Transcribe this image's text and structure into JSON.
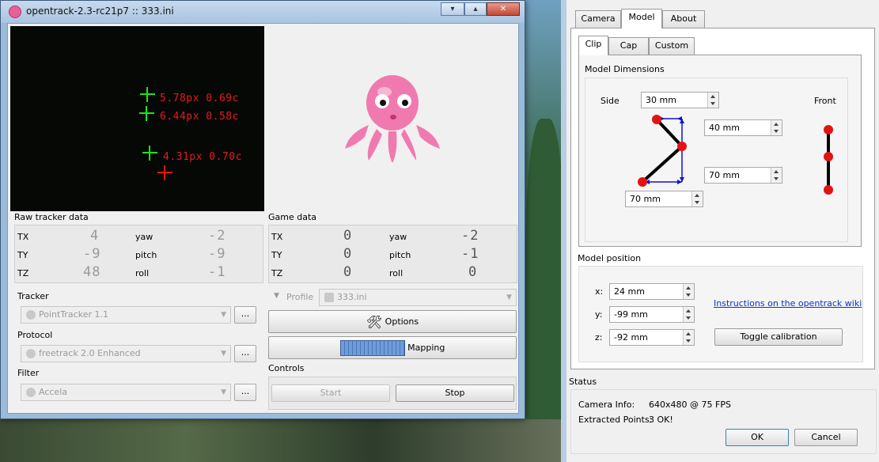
{
  "main_window": {
    "title": "opentrack-2.3-rc21p7 :: 333.ini",
    "minimize_glyph": "▾",
    "restore_glyph": "▴",
    "close_glyph": "✕",
    "video_labels": [
      "5.78px 0.69c",
      "6.44px 0.58c",
      "4.31px 0.70c"
    ]
  },
  "raw_tracker": {
    "title": "Raw tracker data",
    "rows": [
      {
        "label": "TX",
        "value": "4",
        "rot_label": "yaw",
        "rot_value": "-2"
      },
      {
        "label": "TY",
        "value": "-9",
        "rot_label": "pitch",
        "rot_value": "-9"
      },
      {
        "label": "TZ",
        "value": "48",
        "rot_label": "roll",
        "rot_value": "-1"
      }
    ]
  },
  "game_data": {
    "title": "Game data",
    "rows": [
      {
        "label": "TX",
        "value": "0",
        "rot_label": "yaw",
        "rot_value": "-2"
      },
      {
        "label": "TY",
        "value": "0",
        "rot_label": "pitch",
        "rot_value": "-1"
      },
      {
        "label": "TZ",
        "value": "0",
        "rot_label": "roll",
        "rot_value": "0"
      }
    ]
  },
  "modules": {
    "tracker_label": "Tracker",
    "tracker_value": "PointTracker 1.1",
    "protocol_label": "Protocol",
    "protocol_value": "freetrack 2.0 Enhanced",
    "filter_label": "Filter",
    "filter_value": "Accela",
    "dots": "..."
  },
  "profile": {
    "label": "Profile",
    "value": "333.ini",
    "options_label": "Options",
    "mapping_label": "Mapping"
  },
  "controls": {
    "title": "Controls",
    "start_label": "Start",
    "stop_label": "Stop"
  },
  "dialog": {
    "tabs": [
      "Camera",
      "Model",
      "About"
    ],
    "subtabs": [
      "Clip",
      "Cap",
      "Custom"
    ],
    "model_dimensions_title": "Model Dimensions",
    "side_label": "Side",
    "front_label": "Front",
    "side_value": "30 mm",
    "dim_a": "40 mm",
    "dim_b": "70 mm",
    "dim_c": "70 mm",
    "model_position_title": "Model position",
    "x_label": "x:",
    "x_value": "24 mm",
    "y_label": "y:",
    "y_value": "-99 mm",
    "z_label": "z:",
    "z_value": "-92 mm",
    "wiki_link": "Instructions on the opentrack wiki",
    "toggle_label": "Toggle calibration",
    "status_title": "Status",
    "camera_info_label": "Camera Info:",
    "camera_info_value": "640x480 @ 75 FPS",
    "extracted_label": "Extracted Points:",
    "extracted_value": "3 OK!",
    "ok_label": "OK",
    "cancel_label": "Cancel"
  },
  "colors": {
    "accent_red": "#e31313",
    "tracker_green": "#19e619",
    "arrow_blue": "#1010d8"
  }
}
